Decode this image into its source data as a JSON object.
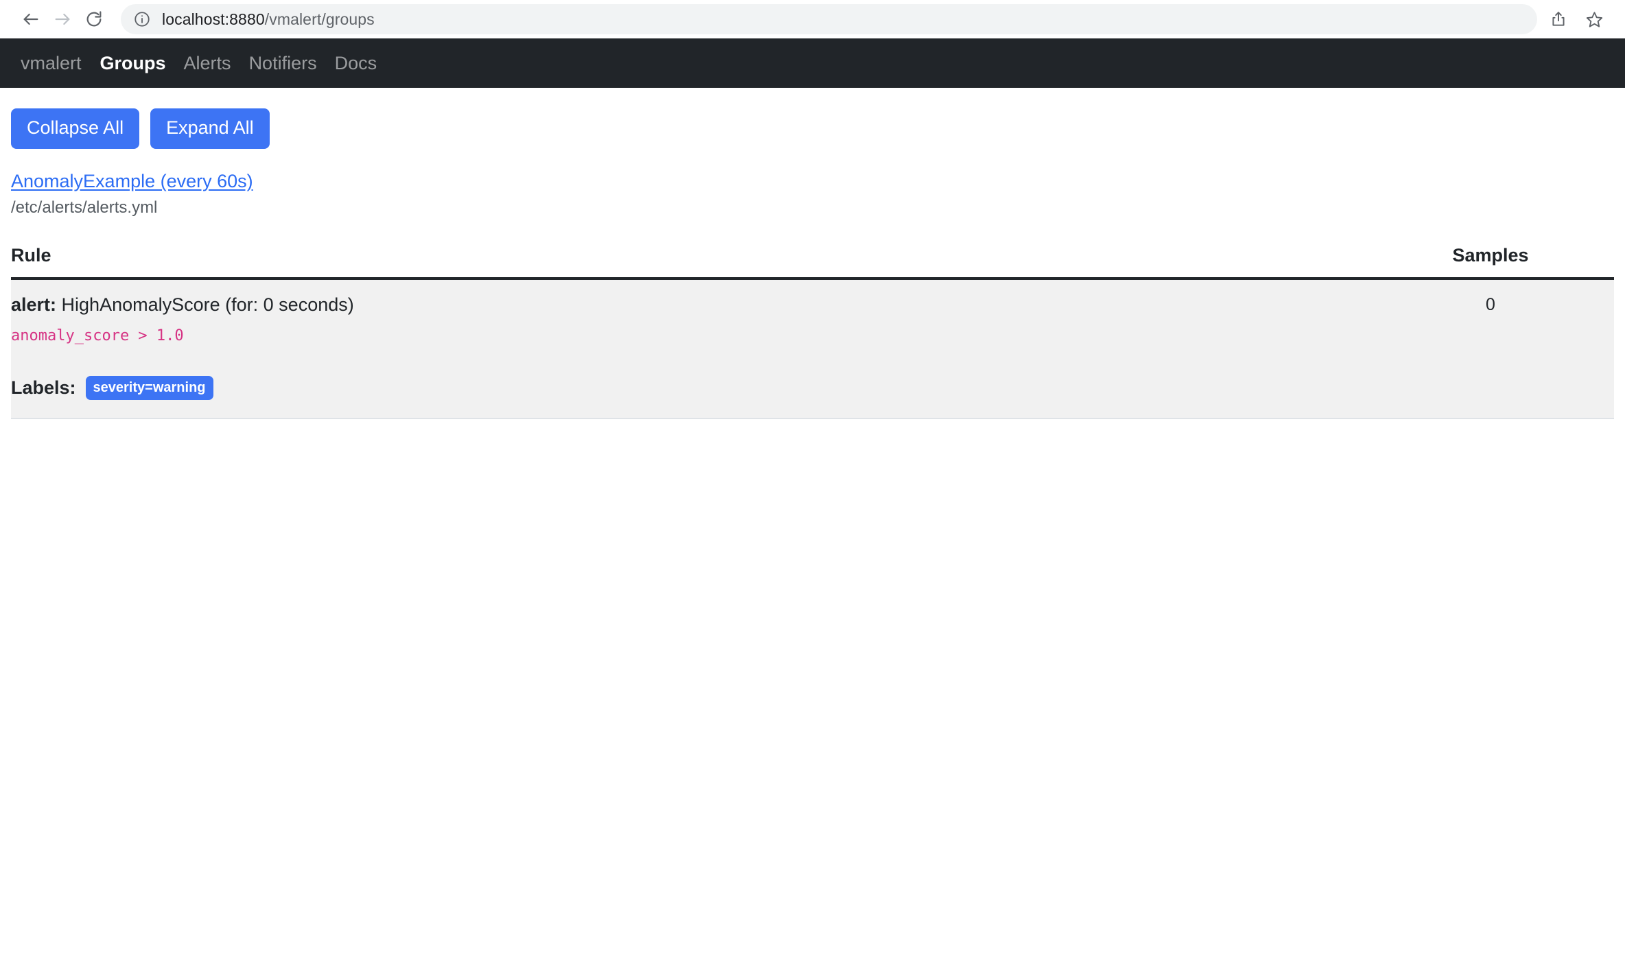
{
  "browser": {
    "back_icon": "back-arrow-icon",
    "forward_icon": "forward-arrow-icon",
    "reload_icon": "reload-icon",
    "site_info_icon": "site-info-icon",
    "share_icon": "share-icon",
    "bookmark_icon": "bookmark-star-icon",
    "url_host": "localhost:8880",
    "url_path": "/vmalert/groups"
  },
  "navbar": {
    "brand": "vmalert",
    "links": [
      {
        "label": "Groups",
        "active": true
      },
      {
        "label": "Alerts",
        "active": false
      },
      {
        "label": "Notifiers",
        "active": false
      },
      {
        "label": "Docs",
        "active": false
      }
    ]
  },
  "toolbar": {
    "collapse_all_label": "Collapse All",
    "expand_all_label": "Expand All"
  },
  "group": {
    "name": "AnomalyExample (every 60s)",
    "file": "/etc/alerts/alerts.yml"
  },
  "table": {
    "headers": {
      "rule": "Rule",
      "samples": "Samples"
    },
    "rows": [
      {
        "kind_label": "alert:",
        "title": "HighAnomalyScore (for: 0 seconds)",
        "expression": "anomaly_score > 1.0",
        "labels_label": "Labels:",
        "labels": [
          "severity=warning"
        ],
        "samples": "0"
      }
    ]
  },
  "colors": {
    "primary": "#3D74F4",
    "link": "#2b6cf4",
    "navbar_bg": "#212529",
    "code": "#d63384",
    "row_bg": "#f1f1f1"
  }
}
